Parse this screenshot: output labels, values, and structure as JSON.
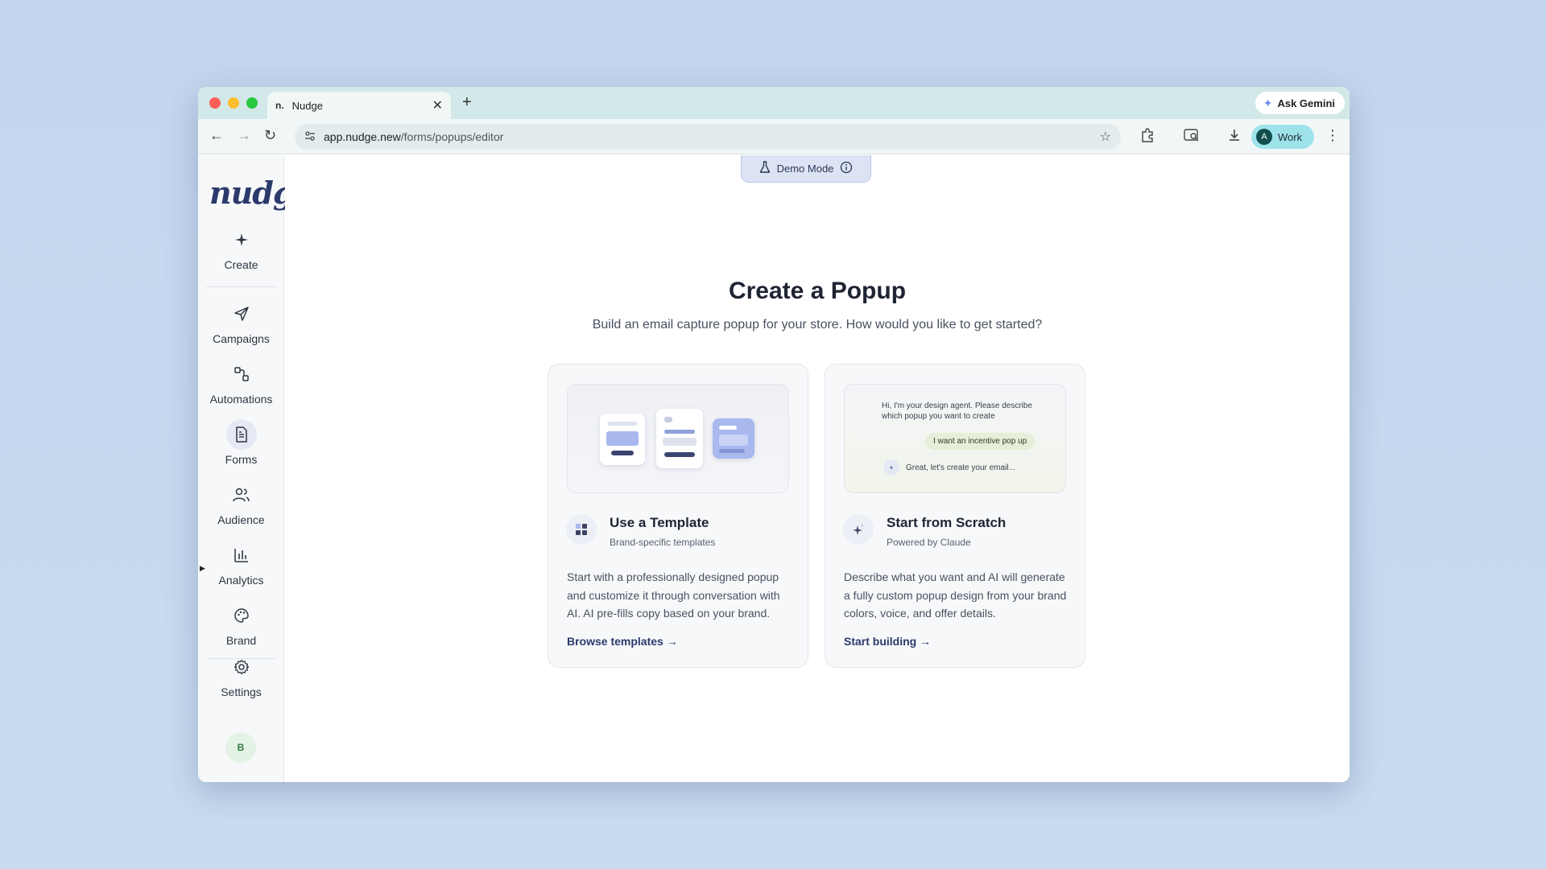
{
  "browser": {
    "tab_title": "Nudge",
    "tab_favicon": "n.",
    "tab_close": "✕",
    "new_tab": "+",
    "ask_gemini": "Ask Gemini",
    "url_host": "app.nudge.new",
    "url_path": "/forms/popups/editor",
    "profile_initial": "A",
    "profile_label": "Work"
  },
  "app": {
    "logo": "nudge",
    "demo_mode": "Demo Mode",
    "nav": {
      "create": "Create",
      "campaigns": "Campaigns",
      "automations": "Automations",
      "forms": "Forms",
      "audience": "Audience",
      "analytics": "Analytics",
      "brand": "Brand",
      "settings": "Settings"
    },
    "user_initial": "B",
    "active_nav": "Forms",
    "accent_color": "#2c4ee0",
    "brand_color": "#2b3a6b"
  },
  "page": {
    "title": "Create a Popup",
    "subtitle": "Build an email capture popup for your store. How would you like to get started?"
  },
  "cards": {
    "template": {
      "title": "Use a Template",
      "tag": "Brand-specific templates",
      "description": "Start with a professionally designed popup and customize it through conversation with AI. AI pre-fills copy based on your brand.",
      "link": "Browse templates →"
    },
    "scratch": {
      "title": "Start from Scratch",
      "tag": "Powered by Claude",
      "description": "Describe what you want and AI will generate a fully custom popup design from your brand colors, voice, and offer details.",
      "link": "Start building →",
      "chat_agent": "Hi, I'm your design agent. Please describe which popup you want to create",
      "chat_user": "I want an incentive pop up",
      "chat_reply": "Great, let's create your email..."
    }
  }
}
